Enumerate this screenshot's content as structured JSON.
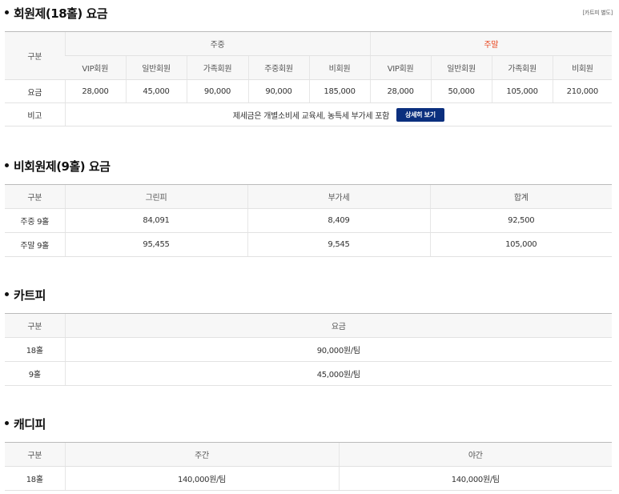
{
  "member": {
    "title": "회원제(18홀) 요금",
    "cart_note": "[카트피 별도]",
    "head_gubun": "구분",
    "weekday_label": "주중",
    "weekend_label": "주말",
    "weekday_cols": [
      "VIP회원",
      "일반회원",
      "가족회원",
      "주중회원",
      "비회원"
    ],
    "weekend_cols": [
      "VIP회원",
      "일반회원",
      "가족회원",
      "비회원"
    ],
    "fee_label": "요금",
    "weekday_fees": [
      "28,000",
      "45,000",
      "90,000",
      "90,000",
      "185,000"
    ],
    "weekend_fees": [
      "28,000",
      "50,000",
      "105,000",
      "210,000"
    ],
    "remark_label": "비고",
    "remark_text": "제세금은 개별소비세 교육세, 농특세 부가세 포함",
    "detail_button": "상세히 보기"
  },
  "nonmember": {
    "title": "비회원제(9홀) 요금",
    "headers": [
      "구분",
      "그린피",
      "부가세",
      "합계"
    ],
    "rows": [
      [
        "주중 9홀",
        "84,091",
        "8,409",
        "92,500"
      ],
      [
        "주말 9홀",
        "95,455",
        "9,545",
        "105,000"
      ]
    ]
  },
  "cart": {
    "title": "카트피",
    "headers": [
      "구분",
      "요금"
    ],
    "rows": [
      [
        "18홀",
        "90,000원/팀"
      ],
      [
        "9홀",
        "45,000원/팀"
      ]
    ]
  },
  "caddie": {
    "title": "캐디피",
    "headers": [
      "구분",
      "주간",
      "야간"
    ],
    "rows": [
      [
        "18홀",
        "140,000원/팀",
        "140,000원/팀"
      ]
    ]
  },
  "colors": {
    "weekend": "#e8431b",
    "button": "#0b2f7e"
  }
}
